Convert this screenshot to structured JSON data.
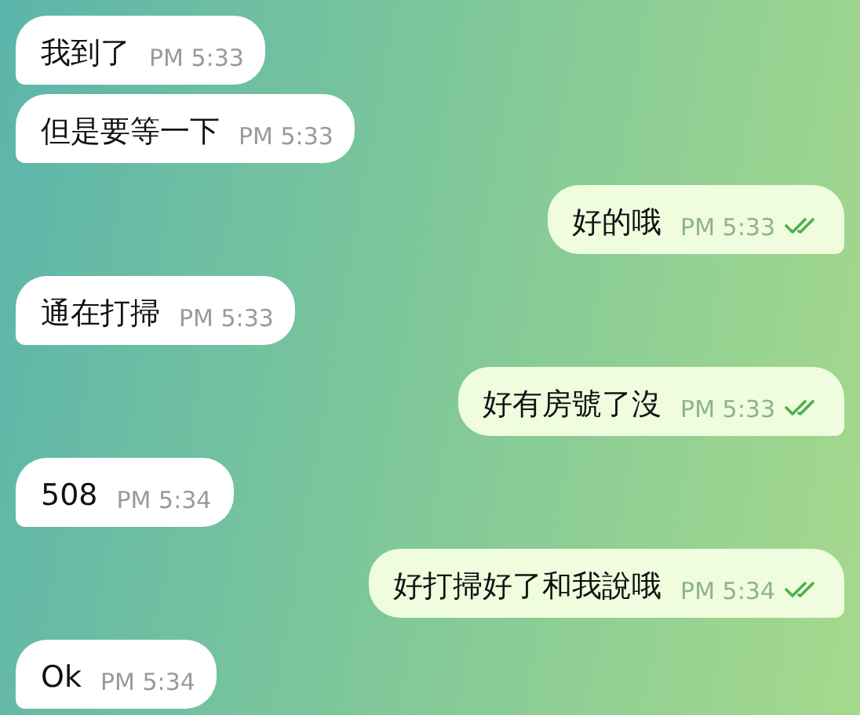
{
  "messages": [
    {
      "kind": "incoming",
      "text": "我到了",
      "time": "PM 5:33"
    },
    {
      "kind": "incoming",
      "text": "但是要等一下",
      "time": "PM 5:33"
    },
    {
      "kind": "outgoing",
      "text": "好的哦",
      "time": "PM 5:33",
      "read": true
    },
    {
      "kind": "incoming",
      "text": "通在打掃",
      "time": "PM 5:33"
    },
    {
      "kind": "outgoing",
      "text": "好有房號了沒",
      "time": "PM 5:33",
      "read": true
    },
    {
      "kind": "incoming",
      "text": "508",
      "time": "PM 5:34"
    },
    {
      "kind": "outgoing",
      "text": "好打掃好了和我說哦",
      "time": "PM 5:34",
      "read": true
    },
    {
      "kind": "incoming",
      "text": "Ok",
      "time": "PM 5:34"
    }
  ]
}
